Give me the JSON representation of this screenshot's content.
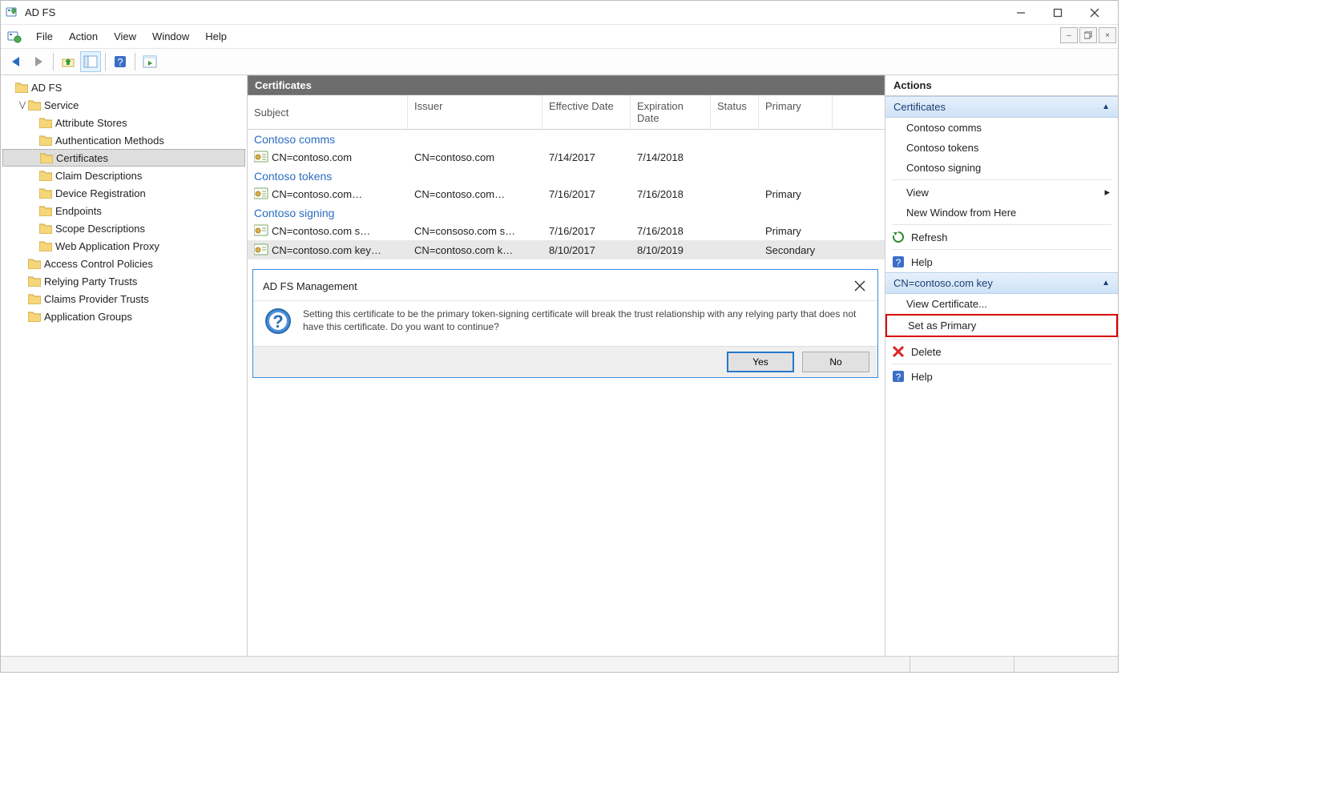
{
  "window": {
    "title": "AD FS"
  },
  "menu": {
    "file": "File",
    "action": "Action",
    "view": "View",
    "window": "Window",
    "help": "Help"
  },
  "tree": {
    "root": "AD FS",
    "service": "Service",
    "items": {
      "attribute_stores": "Attribute Stores",
      "authentication_methods": "Authentication Methods",
      "certificates": "Certificates",
      "claim_descriptions": "Claim Descriptions",
      "device_registration": "Device Registration",
      "endpoints": "Endpoints",
      "scope_descriptions": "Scope Descriptions",
      "web_application_proxy": "Web Application Proxy"
    },
    "access_control_policies": "Access Control Policies",
    "relying_party_trusts": "Relying Party Trusts",
    "claims_provider_trusts": "Claims Provider Trusts",
    "application_groups": "Application Groups"
  },
  "center": {
    "header": "Certificates",
    "columns": {
      "subject": "Subject",
      "issuer": "Issuer",
      "effective": "Effective Date",
      "expiration": "Expiration Date",
      "status": "Status",
      "primary": "Primary"
    },
    "groups": {
      "comms": {
        "title": "Contoso comms",
        "rows": [
          {
            "subject": "CN=contoso.com",
            "issuer": "CN=contoso.com",
            "eff": "7/14/2017",
            "exp": "7/14/2018",
            "status": "",
            "primary": ""
          }
        ]
      },
      "tokens": {
        "title": "Contoso tokens",
        "rows": [
          {
            "subject": "CN=contoso.com…",
            "issuer": "CN=contoso.com…",
            "eff": "7/16/2017",
            "exp": "7/16/2018",
            "status": "",
            "primary": "Primary"
          }
        ]
      },
      "signing": {
        "title": "Contoso signing",
        "rows": [
          {
            "subject": "CN=contoso.com s…",
            "issuer": "CN=consoso.com s…",
            "eff": "7/16/2017",
            "exp": "7/16/2018",
            "status": "",
            "primary": "Primary"
          },
          {
            "subject": "CN=contoso.com key…",
            "issuer": "CN=contoso.com k…",
            "eff": "8/10/2017",
            "exp": "8/10/2019",
            "status": "",
            "primary": "Secondary"
          }
        ]
      }
    }
  },
  "dialog": {
    "title": "AD FS Management",
    "text": "Setting this certificate to be the primary token-signing certificate will break the trust relationship with any relying party that does not have this certificate.  Do you want to continue?",
    "yes": "Yes",
    "no": "No"
  },
  "actions": {
    "title": "Actions",
    "section1": "Certificates",
    "items1": {
      "comms": "Contoso comms",
      "tokens": "Contoso tokens",
      "signing": "Contoso signing",
      "view": "View",
      "new_window": "New Window from Here",
      "refresh": "Refresh",
      "help": "Help"
    },
    "section2": "CN=contoso.com key",
    "items2": {
      "view_cert": "View Certificate...",
      "set_primary": "Set as Primary",
      "delete": "Delete",
      "help": "Help"
    }
  }
}
